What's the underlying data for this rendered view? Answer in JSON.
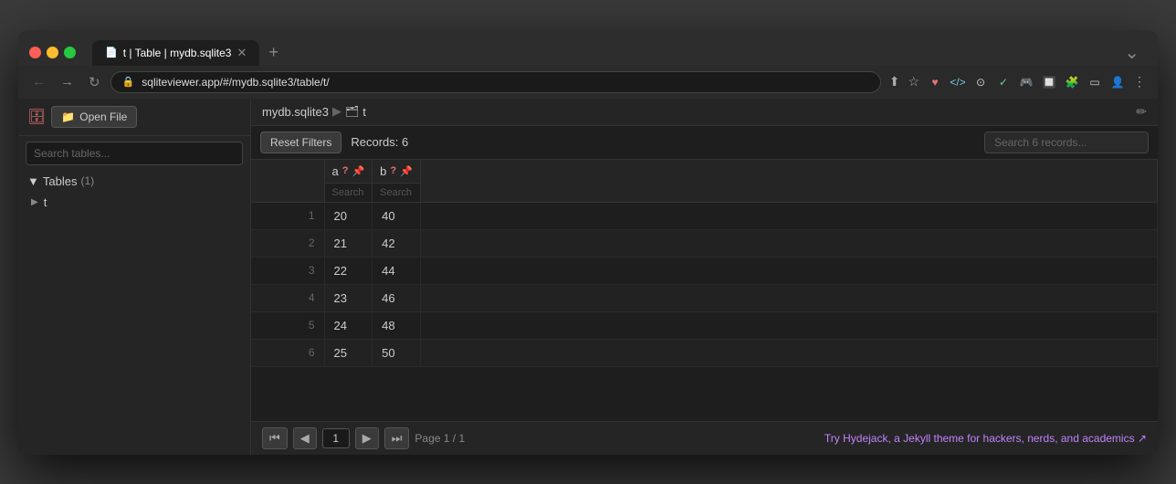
{
  "browser": {
    "tab_label": "t | Table | mydb.sqlite3",
    "address": "sqliteviewer.app/#/mydb.sqlite3/table/t/",
    "new_tab_btn": "+"
  },
  "sidebar": {
    "open_file_label": "Open File",
    "search_placeholder": "Search tables...",
    "tables_label": "Tables",
    "tables_count": "(1)",
    "table_name": "t"
  },
  "breadcrumb": {
    "db_name": "mydb.sqlite3",
    "separator": "▶",
    "table_icon": "🗂",
    "table_name": "t"
  },
  "toolbar": {
    "reset_filters_label": "Reset Filters",
    "records_label": "Records: 6",
    "search_placeholder": "Search 6 records..."
  },
  "columns": [
    {
      "name": "a",
      "search_placeholder": "Search column..."
    },
    {
      "name": "b",
      "search_placeholder": "Search column..."
    }
  ],
  "rows": [
    {
      "num": 1,
      "a": "20",
      "b": "40"
    },
    {
      "num": 2,
      "a": "21",
      "b": "42"
    },
    {
      "num": 3,
      "a": "22",
      "b": "44"
    },
    {
      "num": 4,
      "a": "23",
      "b": "46"
    },
    {
      "num": 5,
      "a": "24",
      "b": "48"
    },
    {
      "num": 6,
      "a": "25",
      "b": "50"
    }
  ],
  "pagination": {
    "page_value": "1",
    "page_info": "Page 1 / 1",
    "first_label": "⏮",
    "prev_label": "◀",
    "next_label": "▶",
    "last_label": "⏭"
  },
  "footer": {
    "hydejack_text": "Try Hydejack, a Jekyll theme for hackers, nerds, and academics ↗"
  }
}
